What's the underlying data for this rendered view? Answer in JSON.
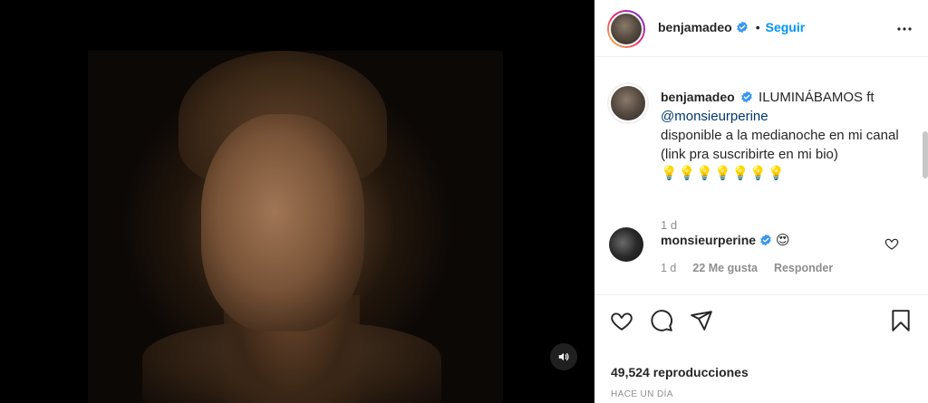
{
  "post": {
    "author": "benjamadeo",
    "follow_label": "Seguir",
    "dot": "•",
    "caption_lead": "ILUMINÁBAMOS ft",
    "caption_mention": "@monsieurperine",
    "caption_body": "disponible a la medianoche en mi canal (link pra suscribirte en mi bio)",
    "caption_bulbs": "💡💡💡💡💡💡💡",
    "caption_time": "1 d"
  },
  "comment": {
    "author": "monsieurperine",
    "emoji": "😍",
    "time": "1 d",
    "likes": "22 Me gusta",
    "reply": "Responder"
  },
  "stats": {
    "views_count": "49,524",
    "views_label": "reproducciones",
    "time_ago": "HACE UN DÍA"
  },
  "colors": {
    "accent": "#0095f6",
    "verified": "#3897f0",
    "text": "#262626",
    "muted": "#8e8e8e"
  }
}
